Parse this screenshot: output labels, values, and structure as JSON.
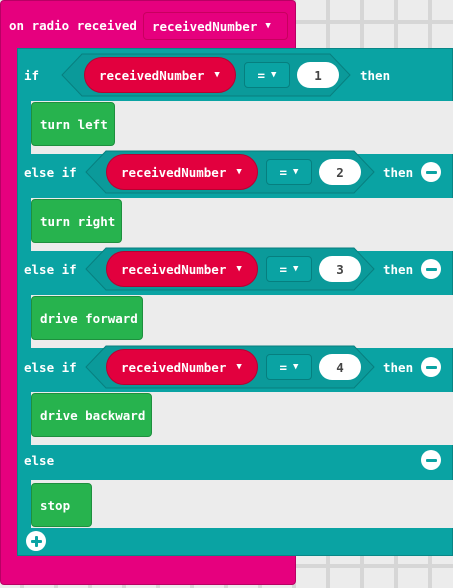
{
  "event_block": {
    "label": "on radio received",
    "param": "receivedNumber",
    "color": "#e6007e"
  },
  "if_block": {
    "color": "#0aa3a3",
    "if_label": "if",
    "else_if_label": "else if",
    "else_label": "else",
    "then_label": "then",
    "variable": "receivedNumber",
    "operator": "=",
    "branches": [
      {
        "value": "1",
        "action": "turn left"
      },
      {
        "value": "2",
        "action": "turn right"
      },
      {
        "value": "3",
        "action": "drive forward"
      },
      {
        "value": "4",
        "action": "drive backward"
      }
    ],
    "else_action": "stop"
  },
  "colors": {
    "variable_pill": "#e2003e",
    "action_block": "#27b34e",
    "workspace": "#ececec"
  },
  "icons": {
    "remove": "minus-circle-icon",
    "add": "plus-circle-icon",
    "dropdown": "caret-down-icon"
  }
}
